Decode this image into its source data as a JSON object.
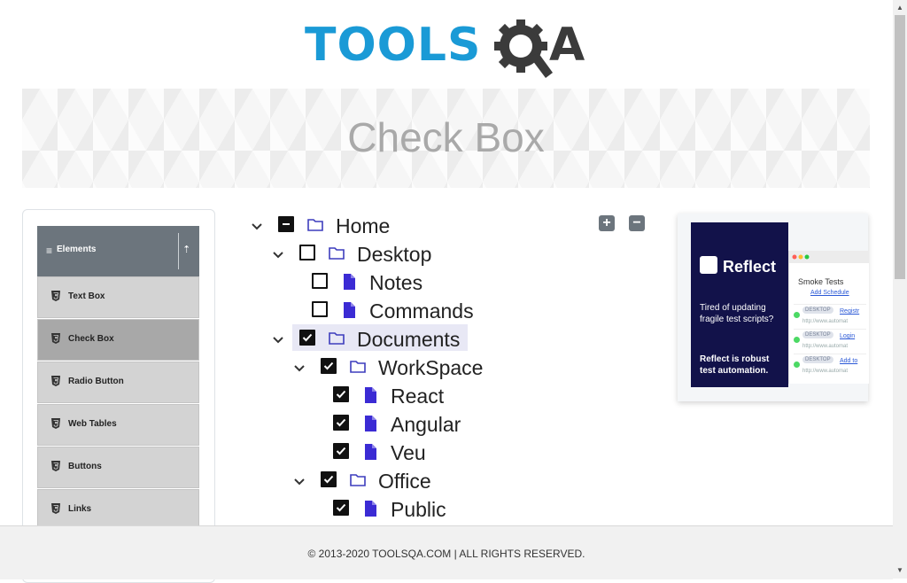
{
  "header": {
    "logo_text": "TOOLSQA",
    "logo_main": "TOOLS",
    "logo_q": "Q",
    "logo_end": "A"
  },
  "banner": {
    "title": "Check Box"
  },
  "sidebar": {
    "group_title": "Elements",
    "items": [
      {
        "label": "Text Box"
      },
      {
        "label": "Check Box"
      },
      {
        "label": "Radio Button"
      },
      {
        "label": "Web Tables"
      },
      {
        "label": "Buttons"
      },
      {
        "label": "Links"
      }
    ]
  },
  "tree": {
    "expand_all": "+",
    "collapse_all": "−",
    "nodes": [
      {
        "label": "Home",
        "state": "partial",
        "type": "folder",
        "expanded": true
      },
      {
        "label": "Desktop",
        "state": "unchecked",
        "type": "folder",
        "expanded": true
      },
      {
        "label": "Notes",
        "state": "unchecked",
        "type": "file"
      },
      {
        "label": "Commands",
        "state": "unchecked",
        "type": "file"
      },
      {
        "label": "Documents",
        "state": "checked",
        "type": "folder",
        "expanded": true,
        "highlighted": true
      },
      {
        "label": "WorkSpace",
        "state": "checked",
        "type": "folder",
        "expanded": true
      },
      {
        "label": "React",
        "state": "checked",
        "type": "file"
      },
      {
        "label": "Angular",
        "state": "checked",
        "type": "file"
      },
      {
        "label": "Veu",
        "state": "checked",
        "type": "file"
      },
      {
        "label": "Office",
        "state": "checked",
        "type": "folder",
        "expanded": true
      },
      {
        "label": "Public",
        "state": "checked",
        "type": "file"
      }
    ]
  },
  "ad": {
    "brand": "Reflect",
    "tagline": "Tired of updating fragile test scripts?",
    "cta": "Reflect is robust test automation.",
    "panel_title": "Smoke Tests",
    "add_schedule": "Add Schedule",
    "rows": [
      {
        "tag": "DESKTOP",
        "link": "Registr",
        "url": "http://www.automat"
      },
      {
        "tag": "DESKTOP",
        "link": "Login",
        "url": "http://www.automat"
      },
      {
        "tag": "DESKTOP",
        "link": "Add to",
        "url": "http://www.automat"
      }
    ]
  },
  "footer": {
    "text": "© 2013-2020 TOOLSQA.COM | ALL RIGHTS RESERVED."
  },
  "colors": {
    "brand_blue": "#1a9ad6",
    "folder_icon": "#3d3dbd",
    "file_icon": "#3b2bd4",
    "sidebar_header": "#6c757d"
  }
}
